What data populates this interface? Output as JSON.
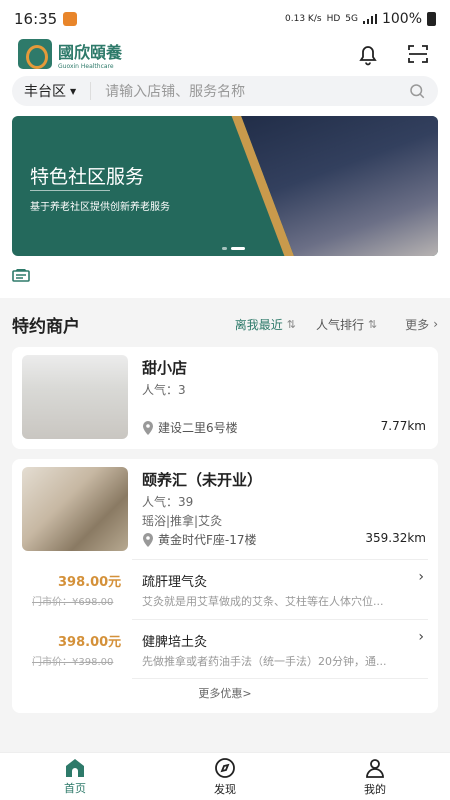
{
  "status_bar": {
    "time": "16:35",
    "net_speed": "0.13 K/s",
    "hd": "HD",
    "signal": "5G",
    "battery": "100%"
  },
  "header": {
    "logo_cn": "國欣頤養",
    "logo_en": "Guoxin Healthcare"
  },
  "search": {
    "district": "丰台区",
    "placeholder": "请输入店铺、服务名称"
  },
  "banner": {
    "title": "特色社区服务",
    "subtitle": "基于养老社区提供创新养老服务"
  },
  "merchants": {
    "title": "特约商户",
    "sort_nearest": "离我最近",
    "sort_popular": "人气排行",
    "more": "更多",
    "shops": [
      {
        "name": "甜小店",
        "popularity": "人气：3",
        "tags": "",
        "address": "建设二里6号楼",
        "distance": "7.77km"
      },
      {
        "name": "颐养汇（未开业）",
        "popularity": "人气：39",
        "tags": "瑶浴|推拿|艾灸",
        "address": "黄金时代F座-17楼",
        "distance": "359.32km",
        "services": [
          {
            "price": "398.00元",
            "original": "门市价：¥698.00",
            "name": "疏肝理气灸",
            "desc": "艾灸就是用艾草做成的艾条、艾柱等在人体穴位..."
          },
          {
            "price": "398.00元",
            "original": "门市价：¥398.00",
            "name": "健脾培土灸",
            "desc": "先做推拿或者药油手法（统一手法）20分钟，通..."
          }
        ],
        "more_deals": "更多优惠>"
      }
    ]
  },
  "tabbar": {
    "home": "首页",
    "discover": "发现",
    "mine": "我的"
  },
  "colors": {
    "brand": "#2e7a6a",
    "accent": "#d4913a"
  }
}
